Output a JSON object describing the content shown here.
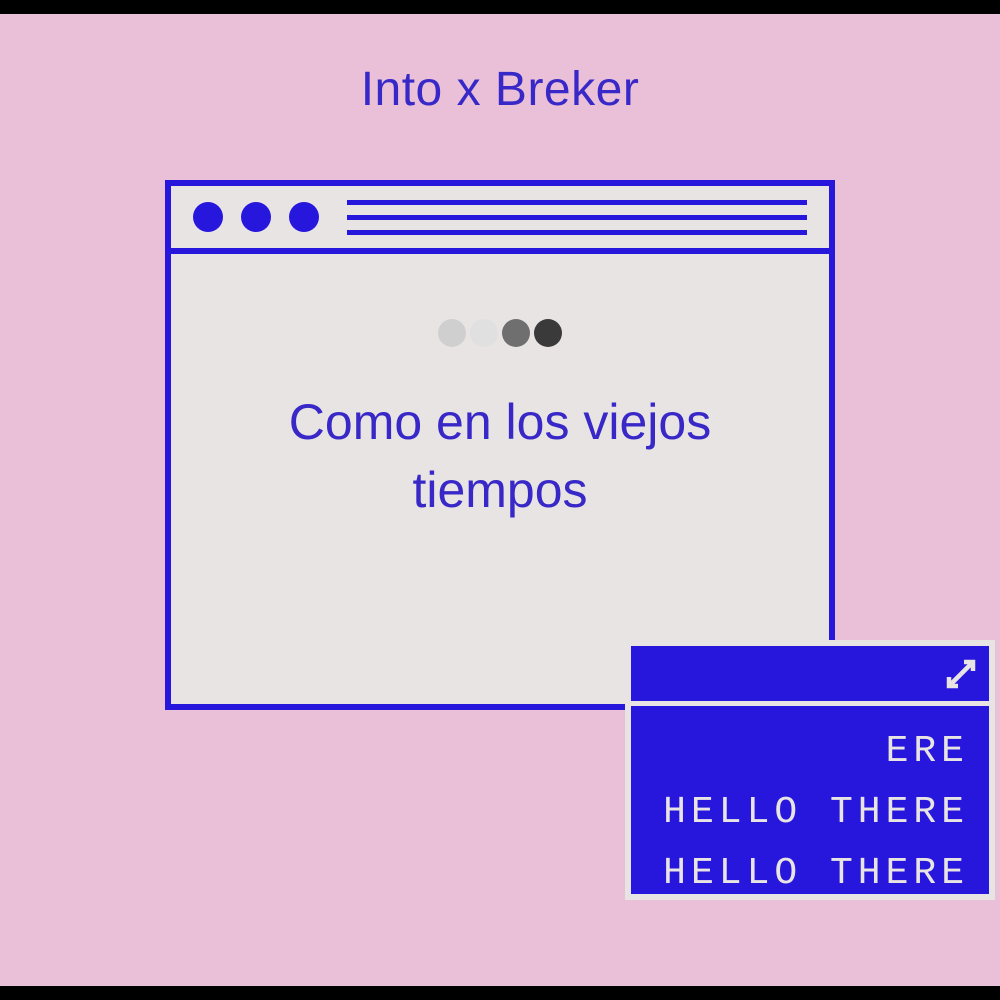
{
  "title": "Into x Breker",
  "main_window": {
    "text": "Como en los viejos tiempos"
  },
  "blue_box": {
    "line1_partial": "ERE",
    "line2": "HELLO THERE",
    "line3": "HELLO THERE"
  }
}
